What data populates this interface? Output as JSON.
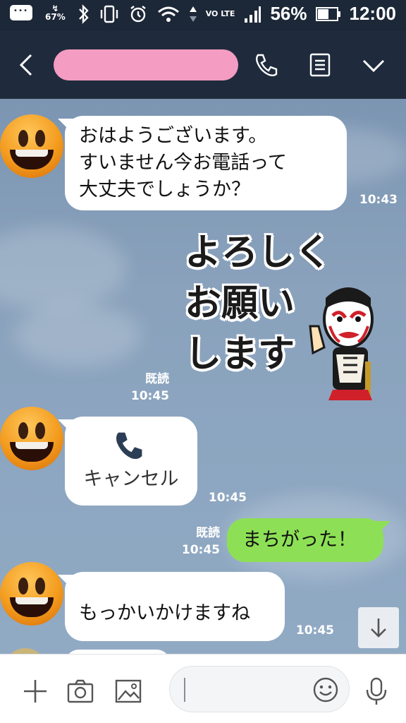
{
  "status_bar": {
    "battery_small": "67%",
    "network_label": "VO LTE",
    "battery_percent": "56%",
    "time": "12:00"
  },
  "header": {
    "title_redacted": true
  },
  "messages": [
    {
      "type": "text",
      "side": "left",
      "lines": [
        "おはようございます。",
        "すいません今お電話って",
        "大丈夫でしょうか？"
      ],
      "time": "10:43"
    },
    {
      "type": "sticker",
      "side": "right",
      "text_lines": [
        "よろしく",
        "お願い",
        "します"
      ],
      "read": "既読",
      "time": "10:45"
    },
    {
      "type": "call",
      "side": "left",
      "label": "キャンセル",
      "time": "10:45"
    },
    {
      "type": "text",
      "side": "right",
      "text": "まちがった！",
      "read": "既読",
      "time": "10:45"
    },
    {
      "type": "text",
      "side": "left",
      "text": "もっかいかけますね",
      "time": "10:45"
    }
  ],
  "colors": {
    "header_bg": "#1f2b3c",
    "chat_bg": "#8aa2bc",
    "sent_bubble": "#8de055",
    "redaction": "#f49cc1"
  },
  "bottom_bar": {
    "icons": [
      "plus-icon",
      "camera-icon",
      "image-icon",
      "emoji-icon",
      "mic-icon"
    ]
  }
}
